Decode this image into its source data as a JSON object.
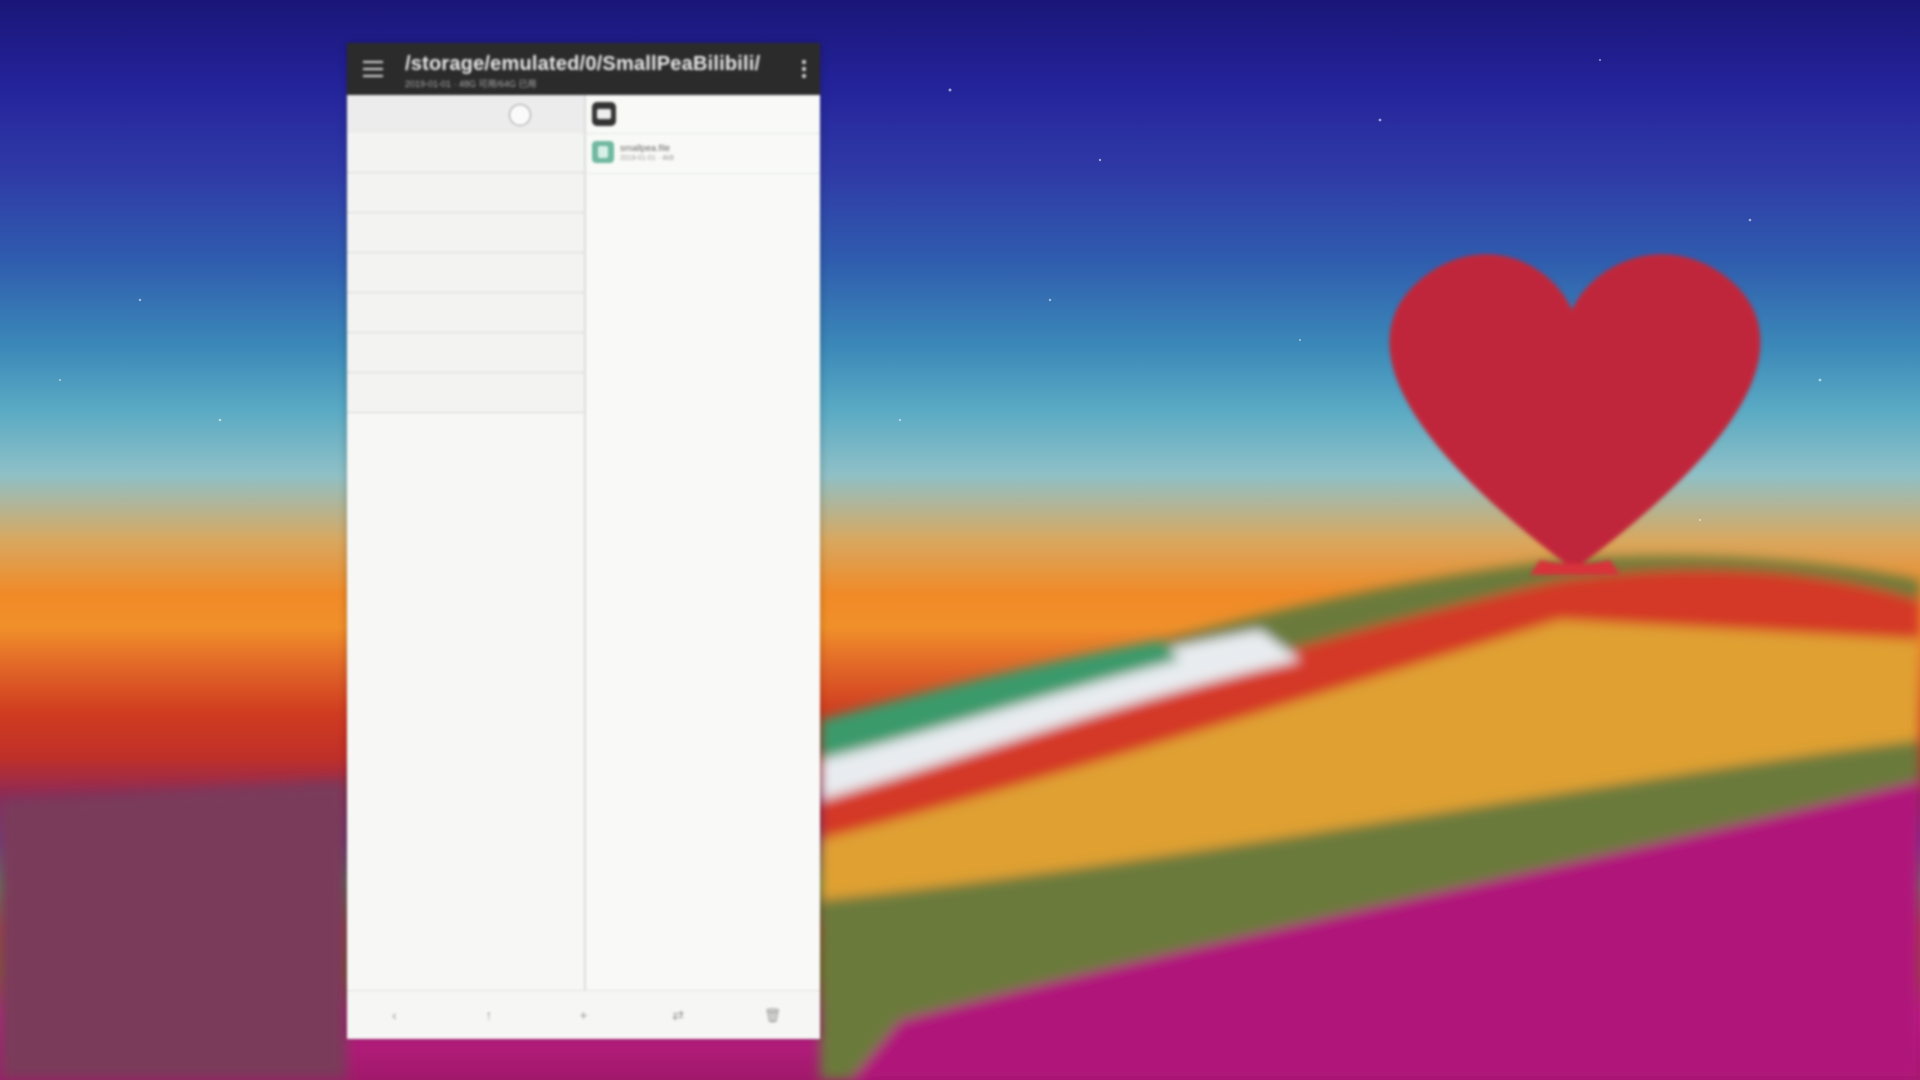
{
  "window": {
    "path_title": "/storage/emulated/0/SmallPeaBilibili/",
    "path_subtitle": "2019-01-01 · 48G 可用/64G 已用"
  },
  "file_list": [
    {
      "name": "smallpea.file",
      "meta": "2019-01-01 · 4kB"
    }
  ],
  "bottom_bar": {
    "back": "‹",
    "up": "↑",
    "add": "+",
    "swap": "⇄",
    "delete": "🗑"
  },
  "icons": [
    "menu-icon",
    "overflow-menu-icon",
    "sd-card-icon",
    "file-icon",
    "back-icon",
    "up-icon",
    "add-icon",
    "swap-icon",
    "delete-icon"
  ],
  "colors": {
    "titlebar": "#2b2b2b",
    "pane_bg": "#f6f7f5",
    "file_icon": "#6fb8a0"
  }
}
